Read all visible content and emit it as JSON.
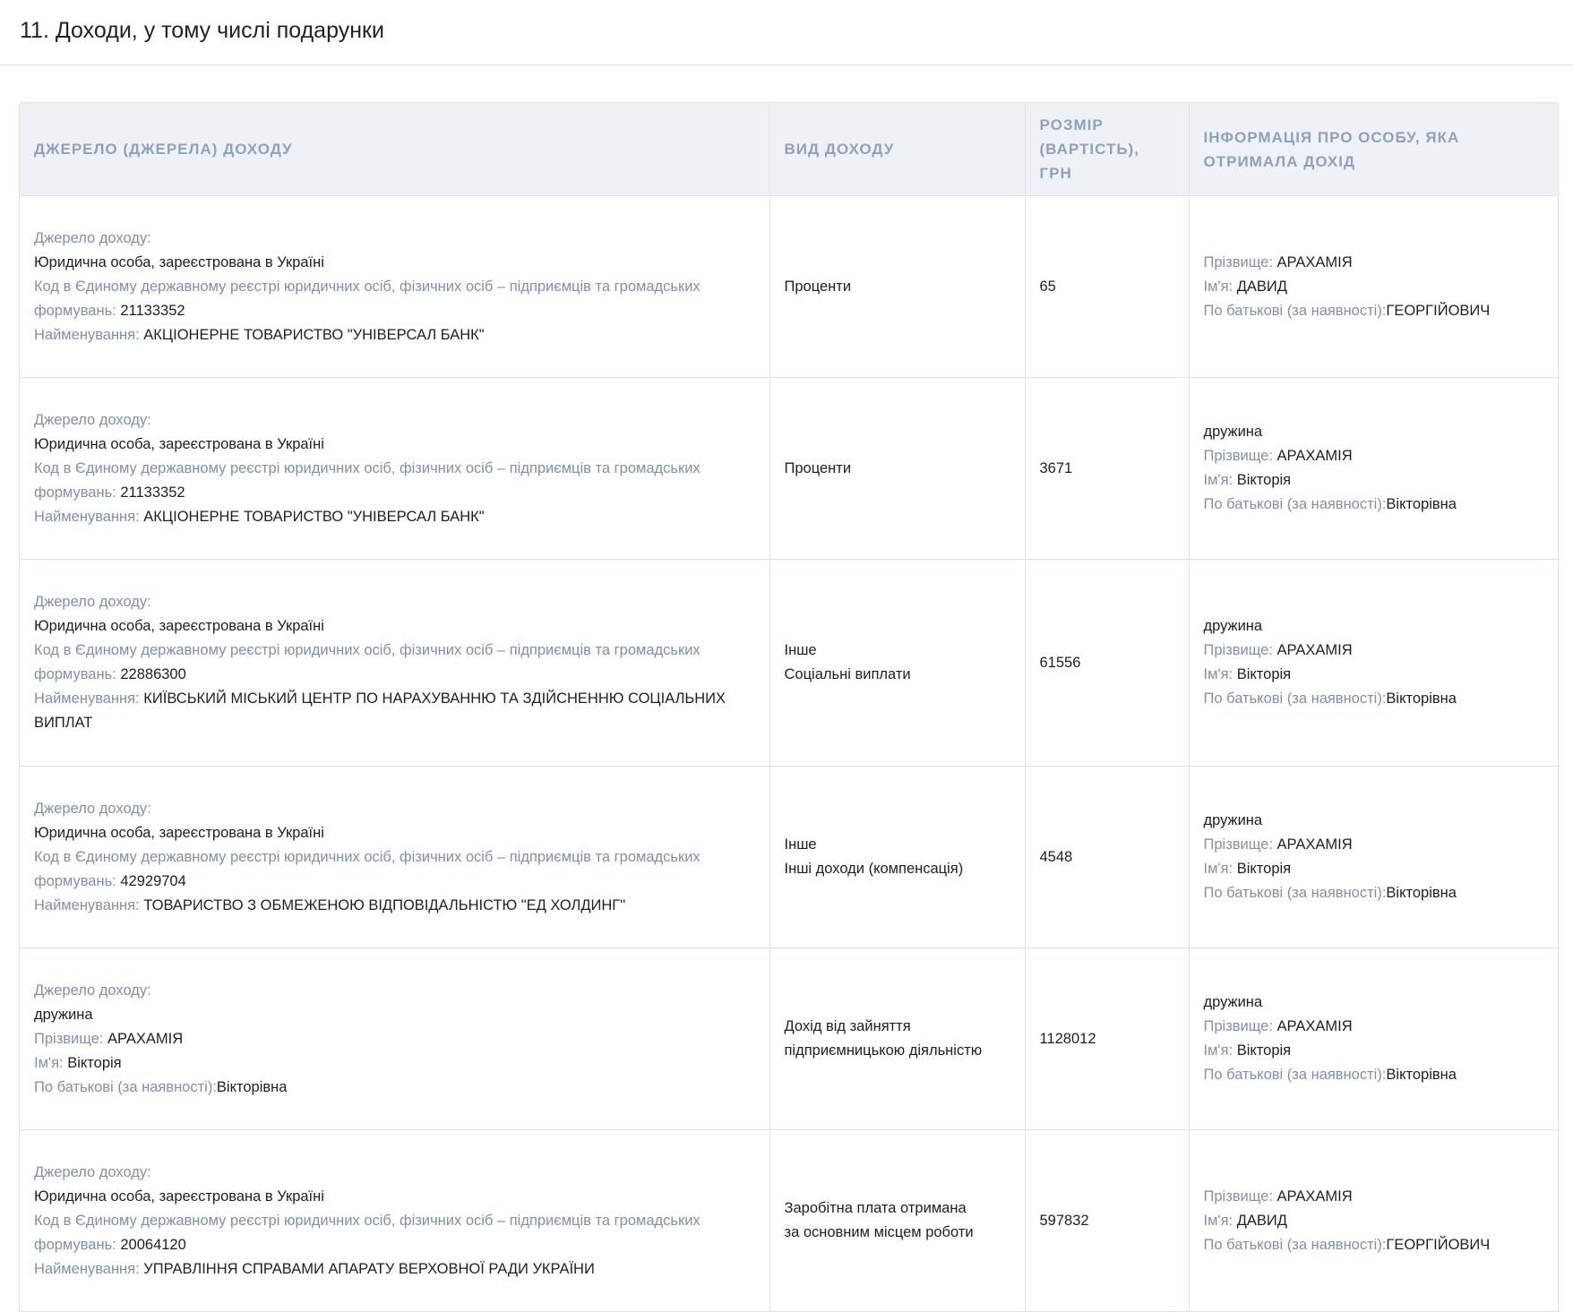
{
  "section": {
    "title": "11. Доходи, у тому числі подарунки"
  },
  "table": {
    "headers": {
      "source": "Джерело (джерела) доходу",
      "type": "Вид доходу",
      "amount": "Розмір (вартість), грн",
      "recipient": "Інформація про особу, яка отримала дохід"
    },
    "labels": {
      "source_heading": "Джерело доходу:",
      "code": "Код в Єдиному державному реєстрі юридичних осіб, фізичних осіб – підприємців та громадських формувань:",
      "name": "Найменування:",
      "surname": "Прізвище:",
      "first_name": "Ім'я:",
      "patronymic": "По батькові (за наявності):"
    },
    "rows": [
      {
        "source_type": "Юридична особа, зареєстрована в Україні",
        "code": "21133352",
        "name": "АКЦІОНЕРНЕ ТОВАРИСТВО \"УНІВЕРСАЛ БАНК\"",
        "income_type": [
          "Проценти"
        ],
        "amount": "65",
        "recipient": {
          "relation": "",
          "surname": "АРАХАМІЯ",
          "first_name": "ДАВИД",
          "patronymic": "ГЕОРГІЙОВИЧ"
        }
      },
      {
        "source_type": "Юридична особа, зареєстрована в Україні",
        "code": "21133352",
        "name": "АКЦІОНЕРНЕ ТОВАРИСТВО \"УНІВЕРСАЛ БАНК\"",
        "income_type": [
          "Проценти"
        ],
        "amount": "3671",
        "recipient": {
          "relation": "дружина",
          "surname": "АРАХАМІЯ",
          "first_name": "Вікторія",
          "patronymic": "Вікторівна"
        }
      },
      {
        "source_type": "Юридична особа, зареєстрована в Україні",
        "code": "22886300",
        "name": "КИЇВСЬКИЙ МІСЬКИЙ ЦЕНТР ПО НАРАХУВАННЮ ТА ЗДІЙСНЕННЮ СОЦІАЛЬНИХ ВИПЛАТ",
        "income_type": [
          "Інше",
          "Соціальні виплати"
        ],
        "amount": "61556",
        "recipient": {
          "relation": "дружина",
          "surname": "АРАХАМІЯ",
          "first_name": "Вікторія",
          "patronymic": "Вікторівна"
        }
      },
      {
        "source_type": "Юридична особа, зареєстрована в Україні",
        "code": "42929704",
        "name": "ТОВАРИСТВО З ОБМЕЖЕНОЮ ВІДПОВІДАЛЬНІСТЮ \"ЕД ХОЛДИНГ\"",
        "income_type": [
          "Інше",
          "Інші доходи (компенсація)"
        ],
        "amount": "4548",
        "recipient": {
          "relation": "дружина",
          "surname": "АРАХАМІЯ",
          "first_name": "Вікторія",
          "patronymic": "Вікторівна"
        }
      },
      {
        "source_person": {
          "relation": "дружина",
          "surname": "АРАХАМІЯ",
          "first_name": "Вікторія",
          "patronymic": "Вікторівна"
        },
        "income_type": [
          "Дохід від зайняття",
          "підприємницькою діяльністю"
        ],
        "amount": "1128012",
        "recipient": {
          "relation": "дружина",
          "surname": "АРАХАМІЯ",
          "first_name": "Вікторія",
          "patronymic": "Вікторівна"
        }
      },
      {
        "source_type": "Юридична особа, зареєстрована в Україні",
        "code": "20064120",
        "name": "УПРАВЛІННЯ СПРАВАМИ АПАРАТУ ВЕРХОВНОЇ РАДИ УКРАЇНИ",
        "income_type": [
          "Заробітна плата отримана",
          "за основним місцем роботи"
        ],
        "amount": "597832",
        "recipient": {
          "relation": "",
          "surname": "АРАХАМІЯ",
          "first_name": "ДАВИД",
          "patronymic": "ГЕОРГІЙОВИЧ"
        }
      }
    ]
  }
}
